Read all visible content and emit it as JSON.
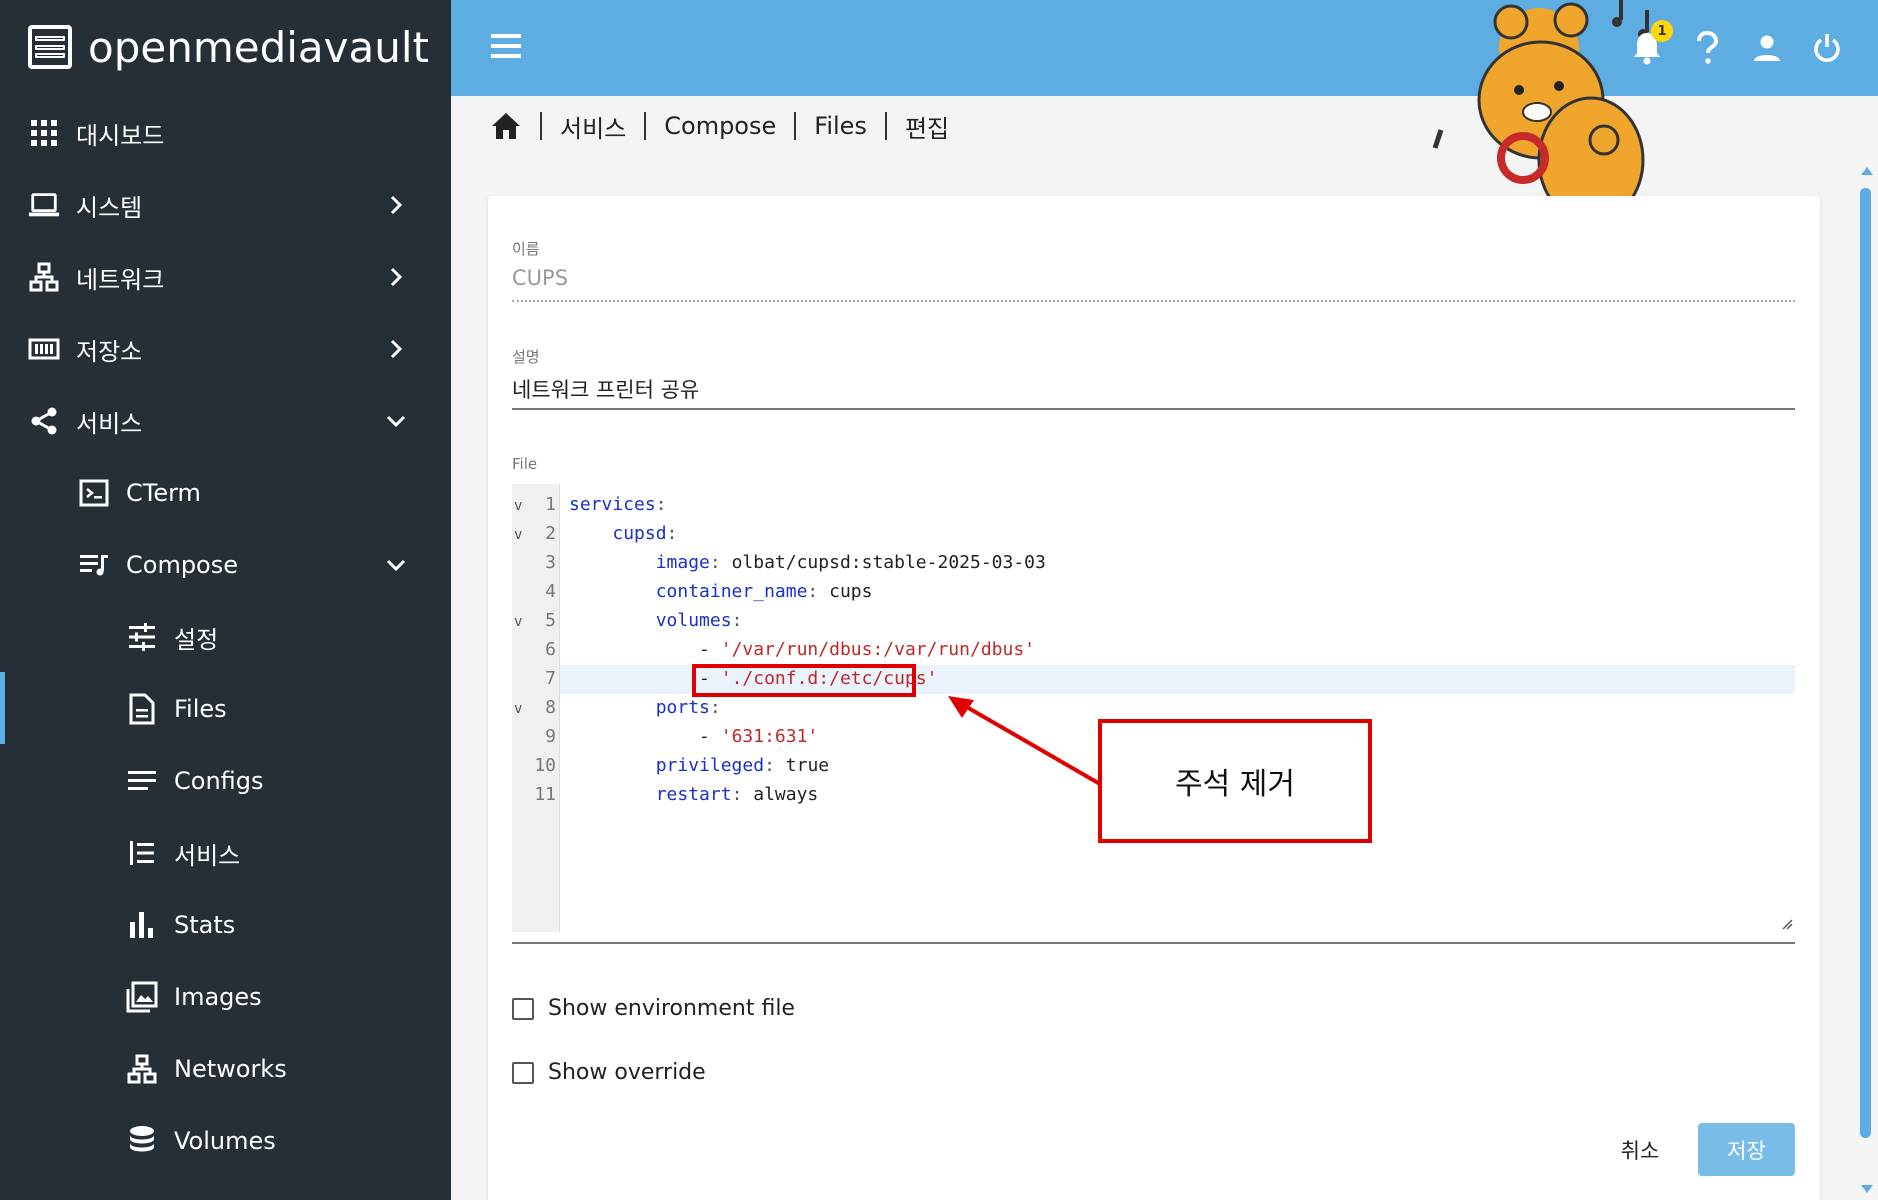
{
  "brand": {
    "name": "openmediavault"
  },
  "sidebar": {
    "items": [
      {
        "label": "대시보드",
        "icon": "grid-icon"
      },
      {
        "label": "시스템",
        "icon": "laptop-icon"
      },
      {
        "label": "네트워크",
        "icon": "network-icon"
      },
      {
        "label": "저장소",
        "icon": "storage-icon"
      },
      {
        "label": "서비스",
        "icon": "share-icon"
      },
      {
        "label": "CTerm",
        "icon": "terminal-icon"
      },
      {
        "label": "Compose",
        "icon": "compose-icon"
      },
      {
        "label": "설정",
        "icon": "settings-sliders-icon"
      },
      {
        "label": "Files",
        "icon": "file-icon"
      },
      {
        "label": "Configs",
        "icon": "lines-icon"
      },
      {
        "label": "서비스",
        "icon": "list-icon"
      },
      {
        "label": "Stats",
        "icon": "bar-chart-icon"
      },
      {
        "label": "Images",
        "icon": "image-icon"
      },
      {
        "label": "Networks",
        "icon": "network-icon"
      },
      {
        "label": "Volumes",
        "icon": "database-icon"
      }
    ]
  },
  "header": {
    "notification_count": "1"
  },
  "breadcrumb": [
    "서비스",
    "Compose",
    "Files",
    "편집"
  ],
  "form": {
    "name_label": "이름",
    "name_value": "CUPS",
    "desc_label": "설명",
    "desc_value": "네트워크 프린터 공유",
    "file_label": "File"
  },
  "code_lines": [
    "1",
    "2",
    "3",
    "4",
    "5",
    "6",
    "7",
    "8",
    "9",
    "10",
    "11"
  ],
  "code": {
    "l1_key": "services",
    "l2_key": "cupsd",
    "l3_key": "image",
    "l3_val": "olbat/cupsd:stable-2025-03-03",
    "l4_key": "container_name",
    "l4_val": "cups",
    "l5_key": "volumes",
    "l6_val": "'/var/run/dbus:/var/run/dbus'",
    "l7_val": "'./conf.d:/etc/cups'",
    "l8_key": "ports",
    "l9_val": "'631:631'",
    "l10_key": "privileged",
    "l10_val": "true",
    "l11_key": "restart",
    "l11_val": "always"
  },
  "annotation": {
    "text": "주석 제거"
  },
  "options": {
    "show_env": "Show environment file",
    "show_override": "Show override"
  },
  "buttons": {
    "cancel": "취소",
    "save": "저장"
  },
  "colors": {
    "sidebar_bg": "#262f36",
    "header_bg": "#5dade2",
    "accent": "#5dade2",
    "annotation_red": "#e00000",
    "save_button": "#78bde8"
  }
}
